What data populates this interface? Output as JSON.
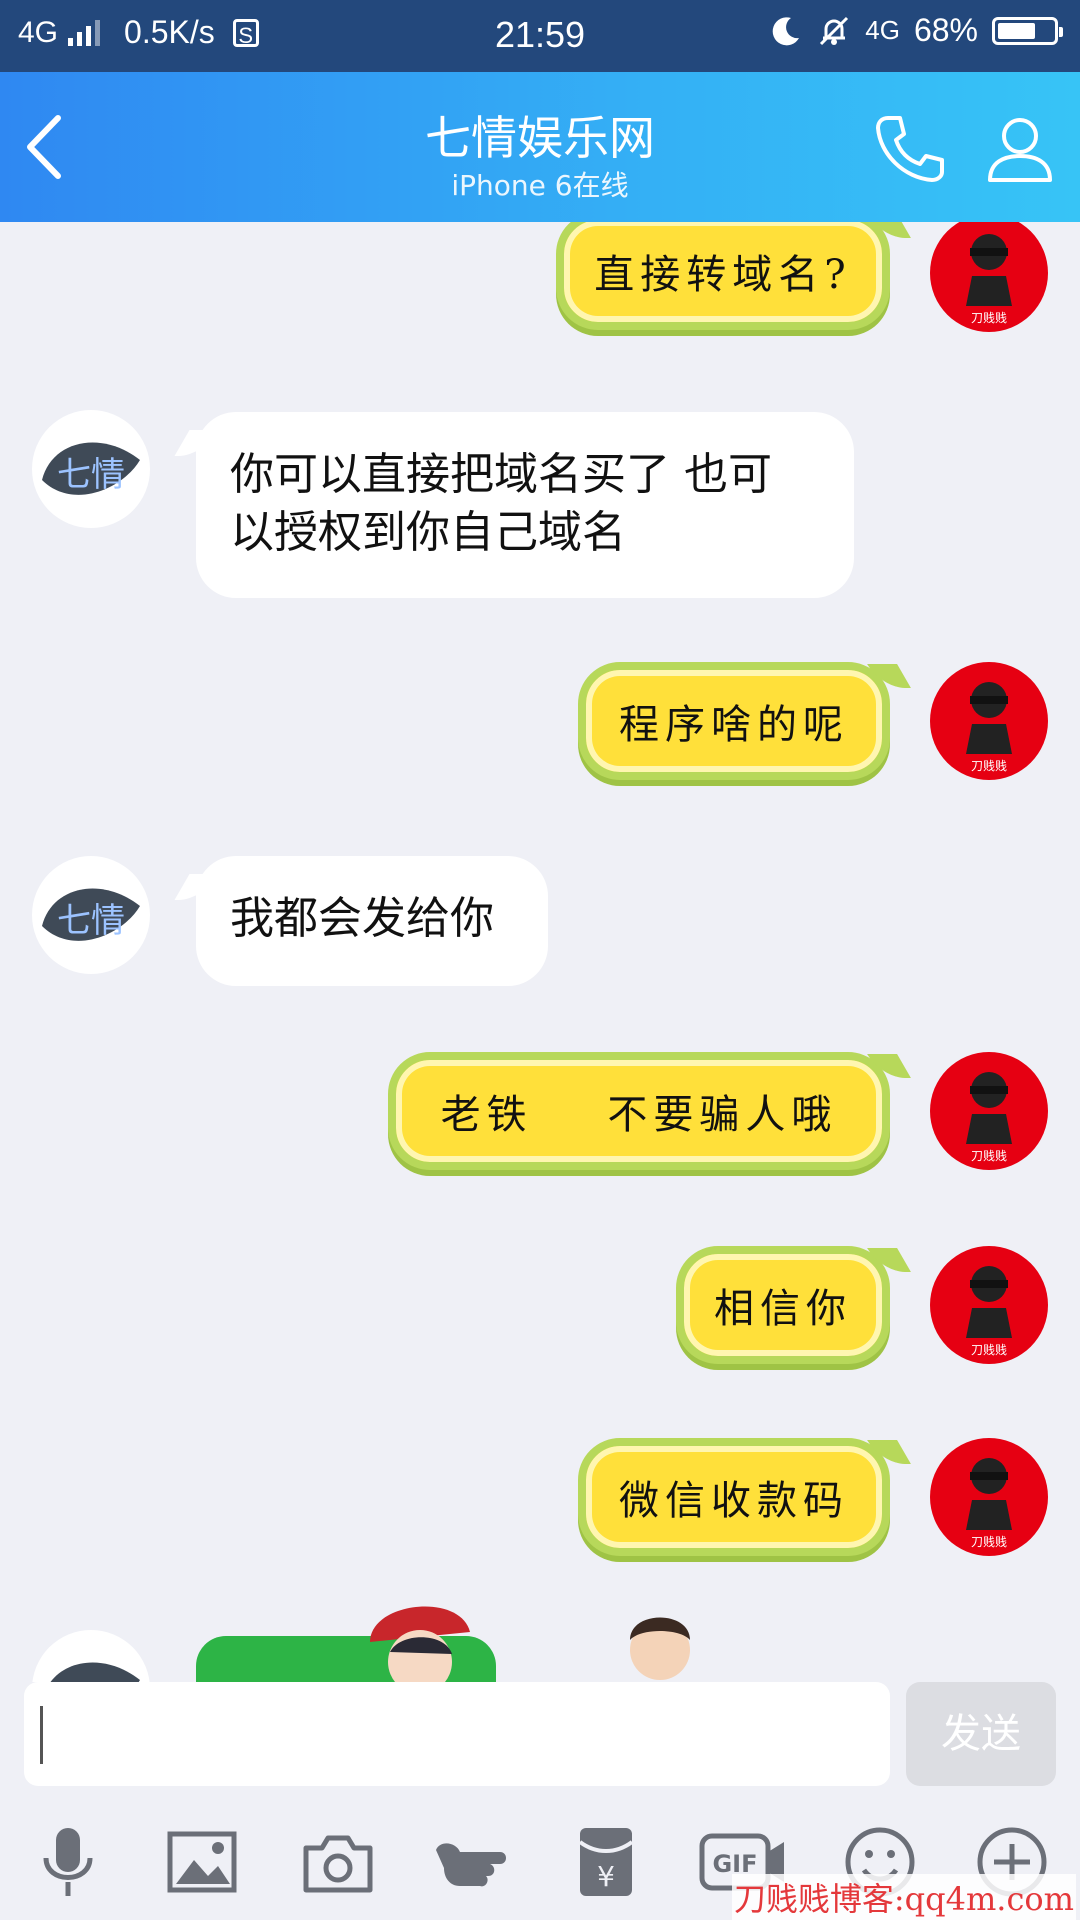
{
  "status_bar": {
    "network": "4G",
    "speed": "0.5K/s",
    "s_icon_text": "S",
    "time": "21:59",
    "network2": "4G",
    "battery": "68%",
    "battery_level": 0.68
  },
  "header": {
    "title": "七情娱乐网",
    "subtitle": "iPhone 6在线"
  },
  "avatars": {
    "me_caption": "刀贱贱",
    "other_glyphs": "七情"
  },
  "messages": [
    {
      "sender": "me",
      "text": "直接转域名?"
    },
    {
      "sender": "other",
      "lines": [
        "你可以直接把域名买了 也可",
        "以授权到你自己域名"
      ]
    },
    {
      "sender": "me",
      "text": "程序啥的呢"
    },
    {
      "sender": "other",
      "lines": [
        "我都会发给你"
      ]
    },
    {
      "sender": "me",
      "text": "老铁    不要骗人哦"
    },
    {
      "sender": "me",
      "text": "相信你"
    },
    {
      "sender": "me",
      "text": "微信收款码"
    }
  ],
  "input": {
    "value": "",
    "send_label": "发送"
  },
  "toolbar": {
    "gif_label": "GIF",
    "yen_label": "¥"
  },
  "watermark": "刀贱贱博客:qq4m.com",
  "colors": {
    "status_bar": "#23487c",
    "header_start": "#2f88f2",
    "header_end": "#37c4f6",
    "chat_bg": "#eff0f6",
    "my_bubble": "#ffe03a",
    "my_bubble_border": "#b7d85a",
    "avatar_me_bg": "#e60012"
  }
}
